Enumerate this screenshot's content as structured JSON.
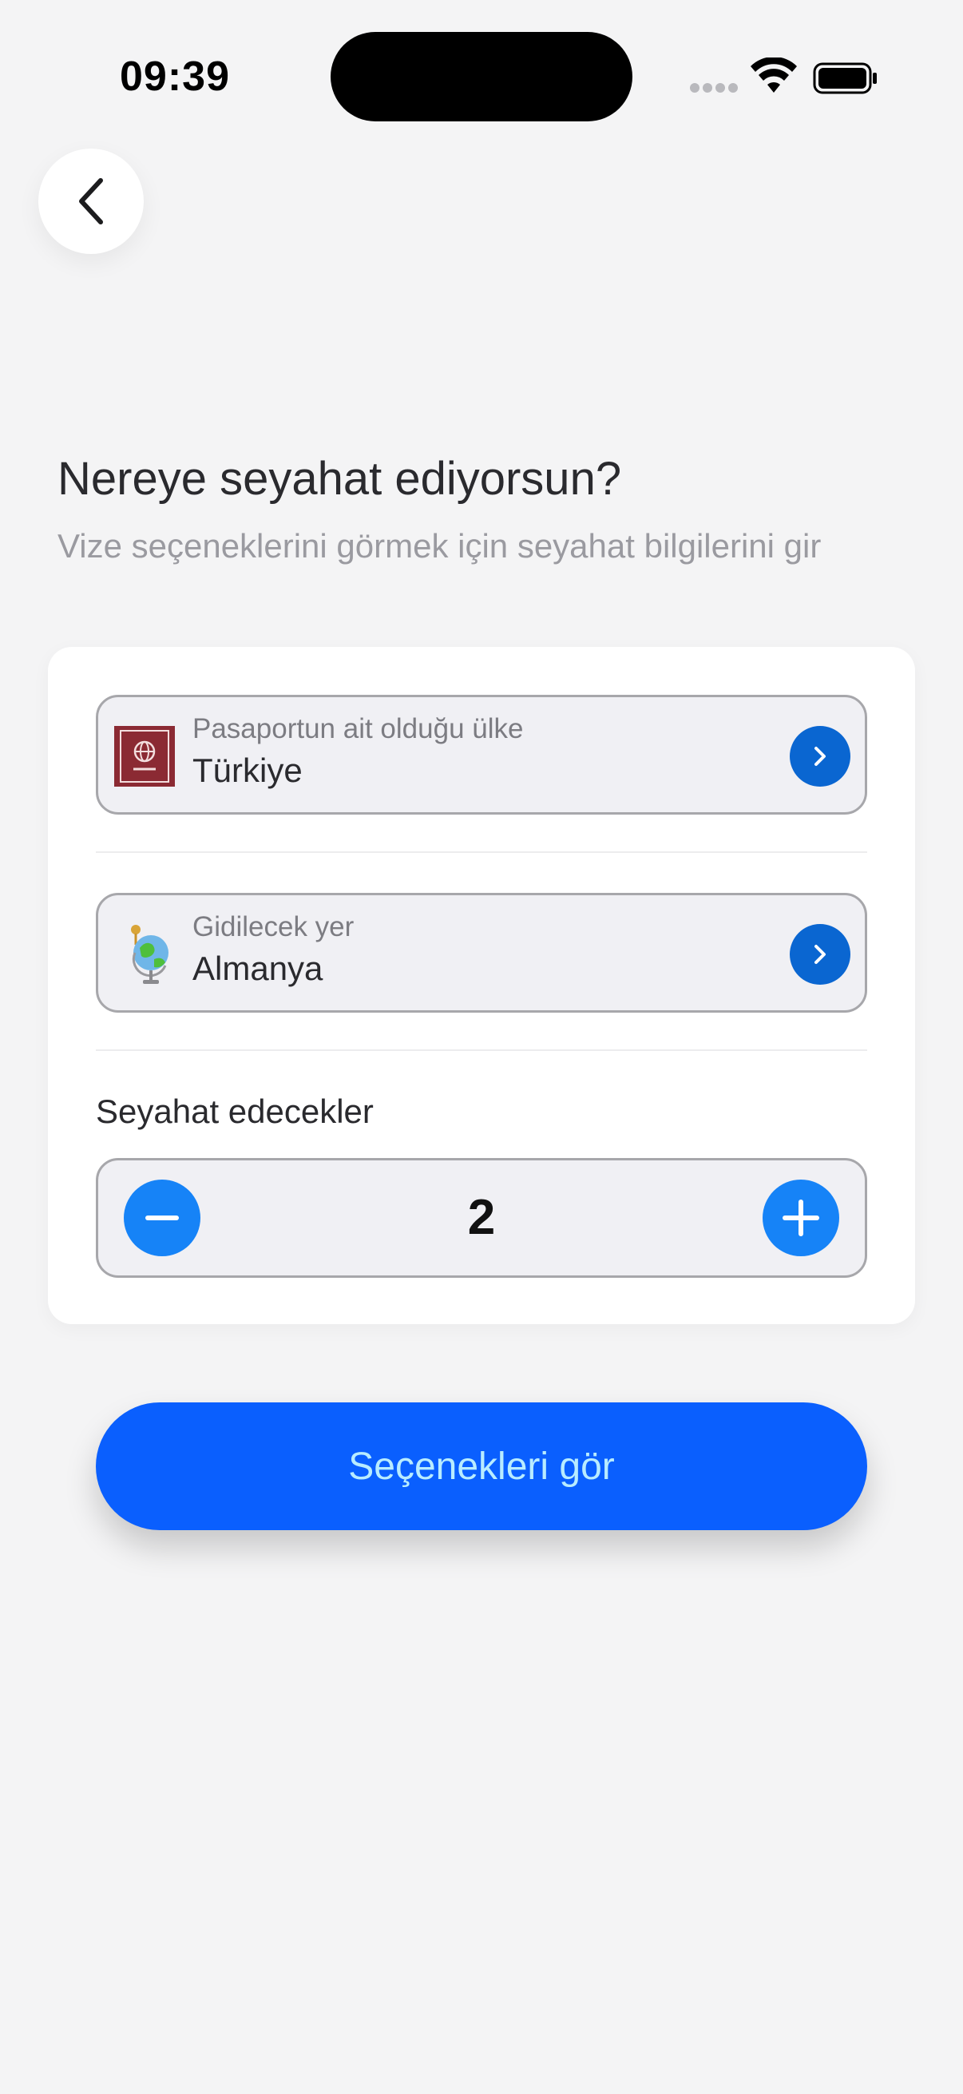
{
  "status_bar": {
    "time": "09:39"
  },
  "header": {
    "title": "Nereye seyahat ediyorsun?",
    "subtitle": "Vize seçeneklerini görmek için seyahat bilgilerini gir"
  },
  "form": {
    "passport": {
      "label": "Pasaportun ait olduğu ülke",
      "value": "Türkiye",
      "icon": "passport-icon"
    },
    "destination": {
      "label": "Gidilecek yer",
      "value": "Almanya",
      "icon": "globe-icon"
    },
    "travelers": {
      "label": "Seyahat edecekler",
      "count": "2"
    }
  },
  "cta": {
    "label": "Seçenekleri gör"
  },
  "colors": {
    "background": "#f4f4f5",
    "accent": "#0a5ffe",
    "chevron_button": "#0a66d1",
    "stepper_button": "#1683f7",
    "passport_icon": "#8b2a33"
  }
}
